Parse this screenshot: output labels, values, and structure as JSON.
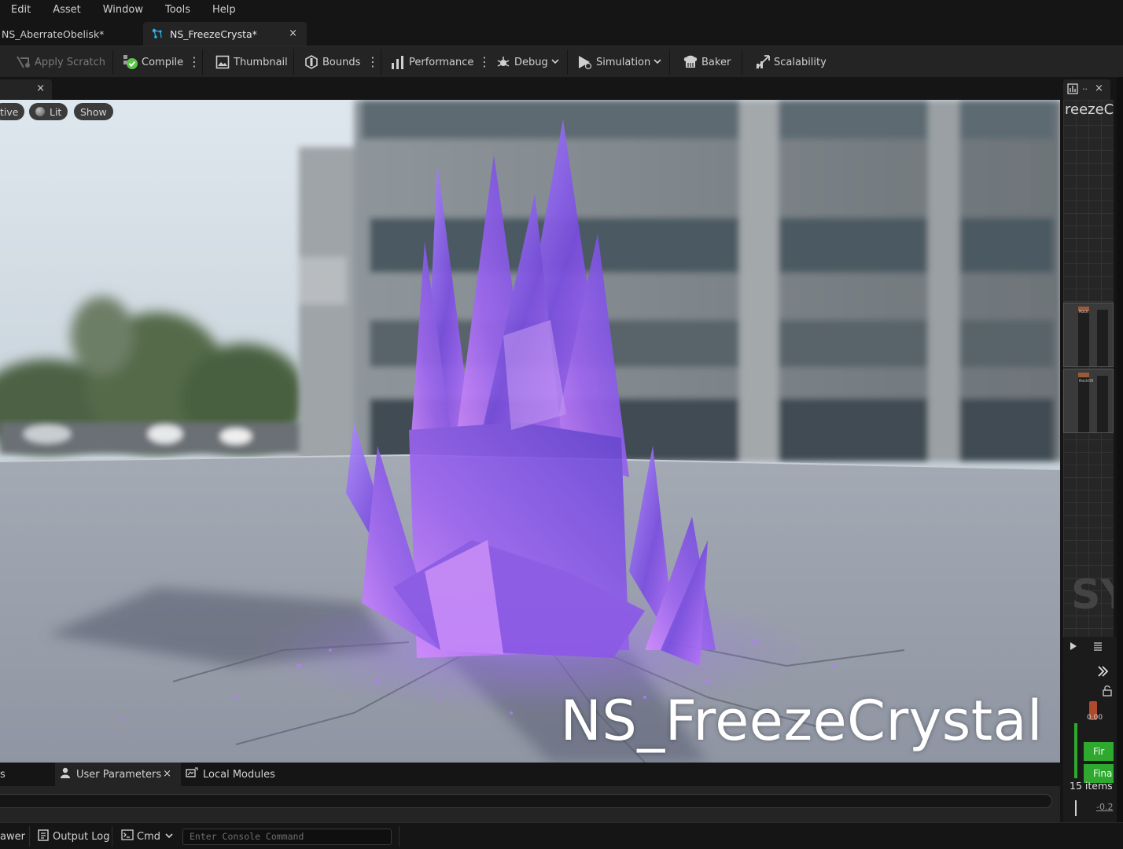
{
  "menu": [
    "Edit",
    "Asset",
    "Window",
    "Tools",
    "Help"
  ],
  "tabs": [
    {
      "label": "NS_AberrateObelisk*"
    },
    {
      "label": "NS_FreezeCrysta*"
    }
  ],
  "tab_close": "×",
  "toolbar": {
    "apply_scratch": "Apply Scratch",
    "compile": "Compile",
    "thumbnail": "Thumbnail",
    "bounds": "Bounds",
    "performance": "Performance",
    "debug": "Debug",
    "simulation": "Simulation",
    "baker": "Baker",
    "scalability": "Scalability"
  },
  "viewport": {
    "perspective_label": "tive",
    "lit_label": "Lit",
    "show_label": "Show",
    "overlay_title": "NS_FreezeCrystal",
    "tab_close": "×"
  },
  "bottom_tabs": {
    "partial_label": "s",
    "user_parameters": "User Parameters",
    "user_parameters_close": "×",
    "local_modules": "Local Modules"
  },
  "status_bar": {
    "drawer_label": "awer",
    "output_log": "Output Log",
    "cmd": "Cmd",
    "console_placeholder": "Enter Console Command"
  },
  "right_panel": {
    "title": "reezeC",
    "tab_close": "×",
    "tab_dots": "..",
    "items_count": "15 items",
    "value": "-0.2",
    "value_small": "0.00",
    "green_row_1": "Fir",
    "green_row_2": "Fina",
    "node_label_1": "Rock",
    "node_label_2": "Rock08",
    "watermark": "SY"
  },
  "colors": {
    "accent_tab_icon": "#29b6e8",
    "crystal": "#8a5ae0",
    "compile_ok": "#5cc44a",
    "node_green": "#2fa82f"
  }
}
